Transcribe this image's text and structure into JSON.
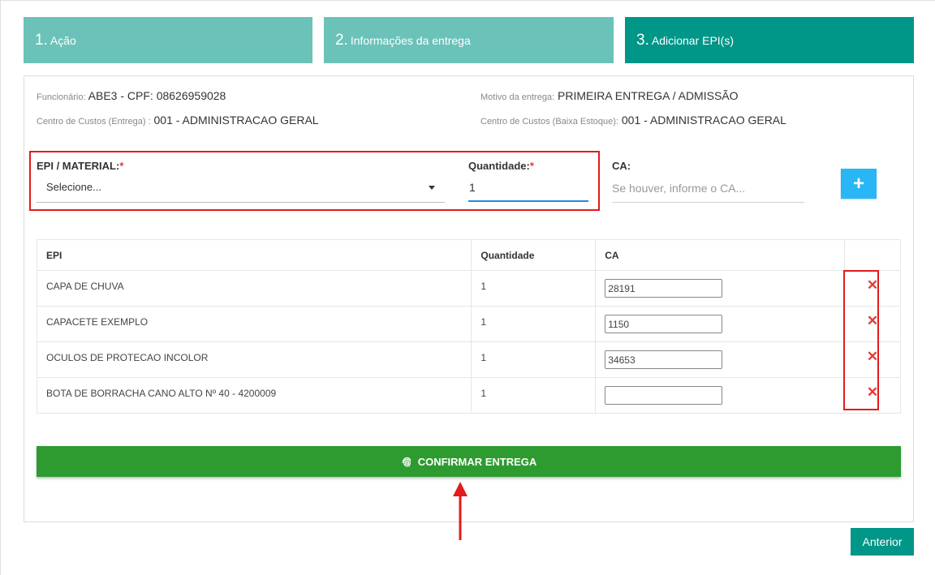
{
  "steps": [
    {
      "num": "1.",
      "label": "Ação"
    },
    {
      "num": "2.",
      "label": "Informações da entrega"
    },
    {
      "num": "3.",
      "label": "Adicionar EPI(s)"
    }
  ],
  "info": {
    "funcionario_label": "Funcionário:",
    "funcionario_value": "ABE3 - CPF: 08626959028",
    "motivo_label": "Motivo da entrega:",
    "motivo_value": "PRIMEIRA ENTREGA / ADMISSÃO",
    "cc_entrega_label": "Centro de Custos (Entrega) :",
    "cc_entrega_value": "001 - ADMINISTRACAO GERAL",
    "cc_baixa_label": "Centro de Custos (Baixa Estoque):",
    "cc_baixa_value": "001 - ADMINISTRACAO GERAL"
  },
  "form": {
    "epi_label": "EPI / MATERIAL:",
    "epi_required": "*",
    "epi_selected": "Selecione...",
    "qty_label": "Quantidade:",
    "qty_required": "*",
    "qty_value": "1",
    "ca_label": "CA:",
    "ca_placeholder": "Se houver, informe o CA...",
    "add_button": "+"
  },
  "table": {
    "headers": [
      "EPI",
      "Quantidade",
      "CA",
      ""
    ],
    "rows": [
      {
        "epi": "CAPA DE CHUVA",
        "qty": "1",
        "ca": "28191"
      },
      {
        "epi": "CAPACETE EXEMPLO",
        "qty": "1",
        "ca": "1150"
      },
      {
        "epi": "OCULOS DE PROTECAO INCOLOR",
        "qty": "1",
        "ca": "34653"
      },
      {
        "epi": "BOTA DE BORRACHA CANO ALTO Nº 40 - 4200009",
        "qty": "1",
        "ca": ""
      }
    ],
    "delete_glyph": "✕"
  },
  "confirm_button": "CONFIRMAR ENTREGA",
  "previous_button": "Anterior",
  "colors": {
    "step_inactive": "#6bc2b8",
    "step_active": "#009688",
    "confirm": "#2e9b31",
    "add": "#29b6f6",
    "annotation": "#e31b1b"
  }
}
